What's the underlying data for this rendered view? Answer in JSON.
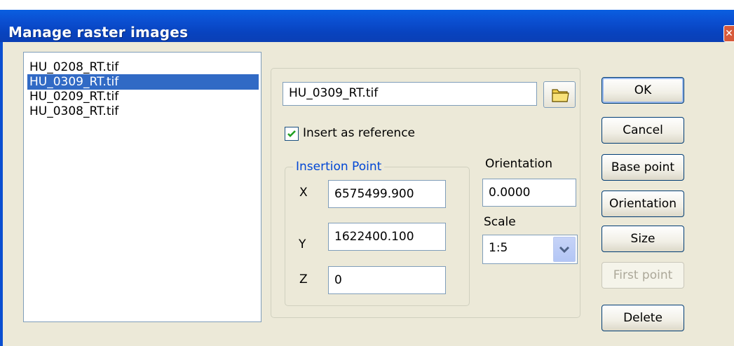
{
  "window": {
    "title": "Manage raster images",
    "close_glyph": "✕"
  },
  "file_list": {
    "items": [
      "HU_0208_RT.tif",
      "HU_0309_RT.tif",
      "HU_0209_RT.tif",
      "HU_0308_RT.tif"
    ],
    "selected_index": 1
  },
  "file_field": {
    "value": "HU_0309_RT.tif"
  },
  "browse_icon": "folder-icon",
  "insert_reference": {
    "label": "Insert as reference",
    "checked": true
  },
  "insertion_point": {
    "legend": "Insertion Point",
    "x_label": "X",
    "x_value": "6575499.900",
    "y_label": "Y",
    "y_value": "1622400.100",
    "z_label": "Z",
    "z_value": "0"
  },
  "orientation": {
    "label": "Orientation",
    "value": "0.0000"
  },
  "scale": {
    "label": "Scale",
    "value": "1:5"
  },
  "buttons": {
    "ok": "OK",
    "cancel": "Cancel",
    "base_point": "Base point",
    "orientation": "Orientation",
    "size": "Size",
    "first_point": "First point",
    "delete": "Delete"
  },
  "colors": {
    "title_bar": "#0b4fd1",
    "selection": "#316ac5",
    "group_legend": "#0046d5",
    "window_bg": "#ece9d8"
  }
}
